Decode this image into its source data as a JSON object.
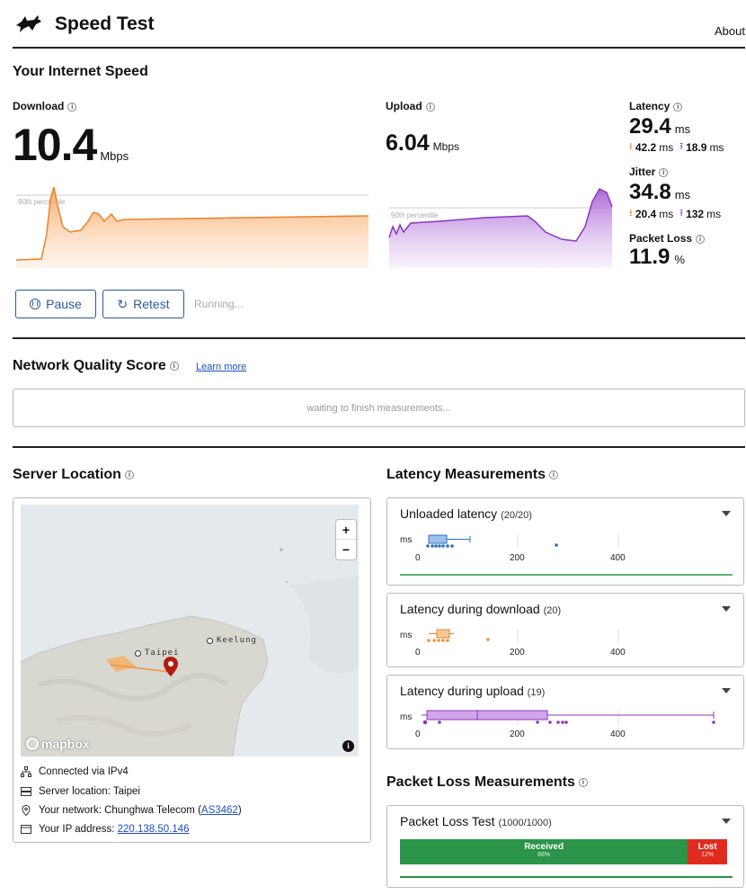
{
  "header": {
    "title": "Speed Test",
    "about": "About"
  },
  "speed": {
    "section_title": "Your Internet Speed",
    "download": {
      "label": "Download",
      "value": "10.4",
      "unit": "Mbps",
      "percentile": "90th percentile"
    },
    "upload": {
      "label": "Upload",
      "value": "6.04",
      "unit": "Mbps",
      "percentile": "90th percentile"
    },
    "latency": {
      "label": "Latency",
      "value": "29.4",
      "unit": "ms",
      "down": "42.2",
      "down_unit": "ms",
      "up": "18.9",
      "up_unit": "ms"
    },
    "jitter": {
      "label": "Jitter",
      "value": "34.8",
      "unit": "ms",
      "down": "20.4",
      "down_unit": "ms",
      "up": "132",
      "up_unit": "ms"
    },
    "packet_loss": {
      "label": "Packet Loss",
      "value": "11.9",
      "unit": "%"
    }
  },
  "controls": {
    "pause": "Pause",
    "retest": "Retest",
    "status": "Running..."
  },
  "quality": {
    "title": "Network Quality Score",
    "learn_more": "Learn more",
    "placeholder": "waiting to finish measurements..."
  },
  "server": {
    "title": "Server Location",
    "map": {
      "zoom_in": "+",
      "zoom_out": "−",
      "city1": "Keelung",
      "city2": "Taipei",
      "attribution": "mapbox",
      "info": "i"
    },
    "connected": "Connected via IPv4",
    "location": "Server location: Taipei",
    "network_prefix": "Your network: Chunghwa Telecom (",
    "network_as": "AS3462",
    "network_suffix": ")",
    "ip_prefix": "Your IP address: ",
    "ip": "220.138.50.146"
  },
  "latency_measurements": {
    "title": "Latency Measurements",
    "unloaded": {
      "label": "Unloaded latency",
      "count": "(20/20)"
    },
    "download": {
      "label": "Latency during download",
      "count": "(20)"
    },
    "upload": {
      "label": "Latency during upload",
      "count": "(19)"
    },
    "axis": {
      "unit": "ms",
      "t0": "0",
      "t1": "200",
      "t2": "400"
    }
  },
  "packet_loss_measurements": {
    "title": "Packet Loss Measurements",
    "test_label": "Packet Loss Test",
    "test_count": "(1000/1000)",
    "received_label": "Received",
    "received_pct": "88%",
    "lost_label": "Lost",
    "lost_pct": "12%",
    "received_fraction": 0.88
  },
  "colors": {
    "download": "#f0913a",
    "upload": "#9b45c8",
    "link": "#1b4fc7",
    "received": "#2a9448",
    "lost": "#e02c1e",
    "unloaded": "#2d6fc0"
  }
}
